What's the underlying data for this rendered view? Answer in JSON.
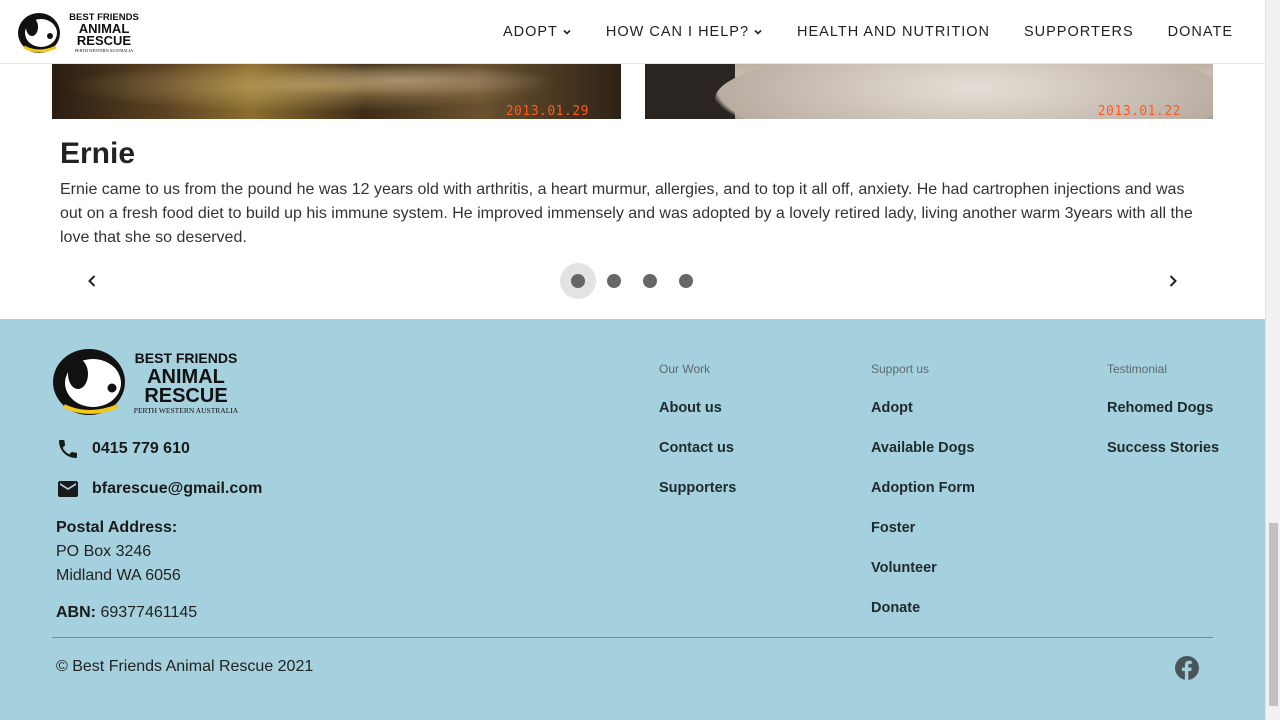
{
  "header": {
    "logo": {
      "line1": "BEST FRIENDS",
      "line2": "ANIMAL",
      "line3": "RESCUE",
      "line4": "PERTH WESTERN AUSTRALIA",
      "icon": "dog-logo-icon"
    },
    "nav": [
      {
        "label": "ADOPT",
        "has_dropdown": true
      },
      {
        "label": "HOW CAN I HELP?",
        "has_dropdown": true
      },
      {
        "label": "HEALTH AND NUTRITION",
        "has_dropdown": false
      },
      {
        "label": "SUPPORTERS",
        "has_dropdown": false
      },
      {
        "label": "DONATE",
        "has_dropdown": false
      }
    ]
  },
  "carousel": {
    "photos": [
      {
        "date_stamp": "2013.01.29"
      },
      {
        "date_stamp": "2013.01.22"
      }
    ],
    "title": "Ernie",
    "text": "Ernie came to us from the pound he was 12 years old with arthritis, a heart murmur, allergies, and to top it all off, anxiety. He had cartrophen injections and was out on a fresh food diet to build up his immune system. He improved immensely and was adopted by a lovely retired lady, living another warm 3years with all the love that she so deserved.",
    "slide_count": 4,
    "active_slide": 1,
    "prev_icon": "chevron-left-icon",
    "next_icon": "chevron-right-icon"
  },
  "footer": {
    "phone": "0415 779 610",
    "email": "bfarescue@gmail.com",
    "postal_label": "Postal Address:",
    "postal_line1": "PO Box 3246",
    "postal_line2": "Midland WA 6056",
    "abn_label": "ABN:",
    "abn_value": "69377461145",
    "columns": {
      "our_work": {
        "heading": "Our Work",
        "links": [
          "About us",
          "Contact us",
          "Supporters"
        ]
      },
      "support_us": {
        "heading": "Support us",
        "links": [
          "Adopt",
          "Available Dogs",
          "Adoption Form",
          "Foster",
          "Volunteer",
          "Donate"
        ]
      },
      "testimonial": {
        "heading": "Testimonial",
        "links": [
          "Rehomed Dogs",
          "Success Stories"
        ]
      }
    },
    "copyright": "© Best Friends Animal Rescue 2021",
    "social_icon": "facebook-icon"
  },
  "colors": {
    "footer_bg": "#a5d0dd",
    "date_stamp": "#ff5a1e",
    "logo_collar": "#f2c81a"
  }
}
